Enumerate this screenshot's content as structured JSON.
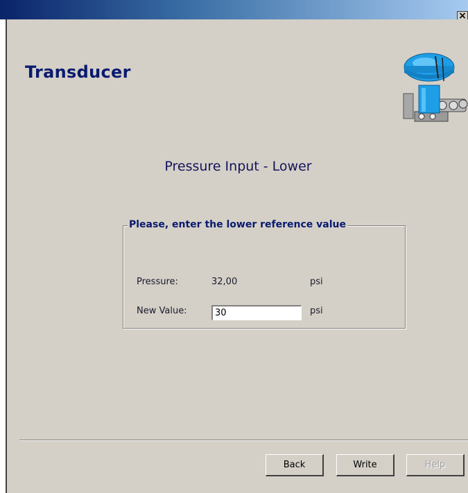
{
  "window": {
    "close_glyph": "×"
  },
  "header": {
    "title": "Transducer",
    "device_icon": "valve-actuator-icon"
  },
  "page": {
    "title": "Pressure Input - Lower"
  },
  "group": {
    "legend": "Please, enter the lower reference value",
    "pressure_label": "Pressure:",
    "pressure_value": "32,00",
    "pressure_unit": "psi",
    "new_value_label": "New Value:",
    "new_value": "30",
    "new_value_unit": "psi"
  },
  "buttons": {
    "back": "Back",
    "write": "Write",
    "help": "Help"
  },
  "colors": {
    "heading": "#0a1a6e",
    "dialog_bg": "#d4d0c8",
    "device_blue": "#1e9ee6"
  }
}
